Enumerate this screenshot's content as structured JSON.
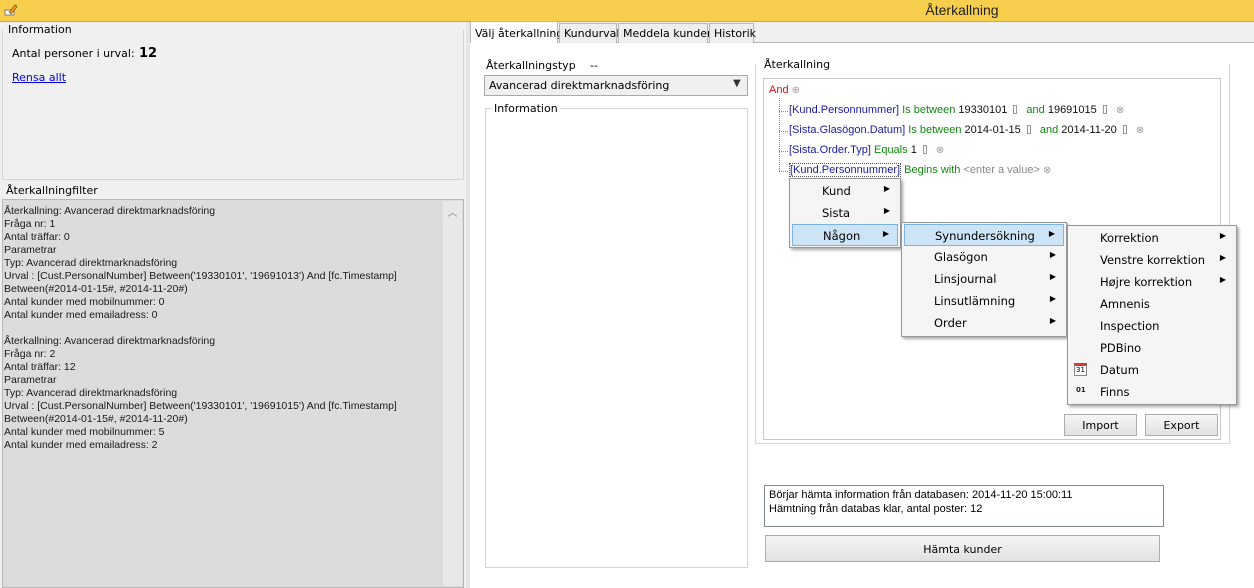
{
  "window": {
    "title": "Återkallning"
  },
  "info": {
    "group_title": "Information",
    "count_label": "Antal personer i urval:",
    "count_value": "12",
    "clear_link": "Rensa allt"
  },
  "filter": {
    "group_title": "Återkallningfilter",
    "text": "Återkallning: Avancerad direktmarknadsföring\nFråga nr: 1\nAntal träffar: 0\nParametrar\nTyp: Avancerad direktmarknadsföring\nUrval : [Cust.PersonalNumber] Between('19330101', '19691013') And [fc.Timestamp]\nBetween(#2014-01-15#, #2014-11-20#)\nAntal kunder med mobilnummer: 0\nAntal kunder med emailadress: 0\n\nÅterkallning: Avancerad direktmarknadsföring\nFråga nr: 2\nAntal träffar: 12\nParametrar\nTyp: Avancerad direktmarknadsföring\nUrval : [Cust.PersonalNumber] Between('19330101', '19691015') And [fc.Timestamp]\nBetween(#2014-01-15#, #2014-11-20#)\nAntal kunder med mobilnummer: 5\nAntal kunder med emailadress: 2"
  },
  "tabs": [
    {
      "label": "Välj återkallning",
      "active": true
    },
    {
      "label": "Kundurval"
    },
    {
      "label": "Meddela kunden"
    },
    {
      "label": "Historik"
    }
  ],
  "recall_type": {
    "label": "Återkallningstyp",
    "dash": "--",
    "selected": "Avancerad direktmarknadsföring"
  },
  "info2": {
    "group_title": "Information"
  },
  "recall": {
    "group_title": "Återkallning",
    "root": "And",
    "rows": [
      {
        "field": "[Kund.Personnummer]",
        "op": "Is between",
        "v1": "19330101",
        "and": "and",
        "v2": "19691015"
      },
      {
        "field": "[Sista.Glasögon.Datum]",
        "op": "Is between",
        "v1": "2014-01-15",
        "and": "and",
        "v2": "2014-11-20"
      },
      {
        "field": "[Sista.Order.Typ]",
        "op": "Equals",
        "v1": "1"
      },
      {
        "field": "[Kund.Personnummer]",
        "op": "Begins with",
        "placeholder": "<enter a value>"
      }
    ]
  },
  "menu1": [
    "Kund",
    "Sista",
    "Någon"
  ],
  "menu2": [
    "Synundersökning",
    "Glasögon",
    "Linsjournal",
    "Linsutlämning",
    "Order"
  ],
  "menu3": [
    "Korrektion",
    "Venstre korrektion",
    "Højre korrektion",
    "Amnenis",
    "Inspection",
    "PDBino",
    "Datum",
    "Finns"
  ],
  "menu3_icons": {
    "datum_icon_text": "31",
    "finns_icon_text": "01"
  },
  "buttons": {
    "import": "Import",
    "export": "Export",
    "fetch": "Hämta kunder"
  },
  "log": [
    "Börjar hämta information från databasen: 2014-11-20 15:00:11",
    "Hämtning från databas klar, antal poster: 12"
  ]
}
